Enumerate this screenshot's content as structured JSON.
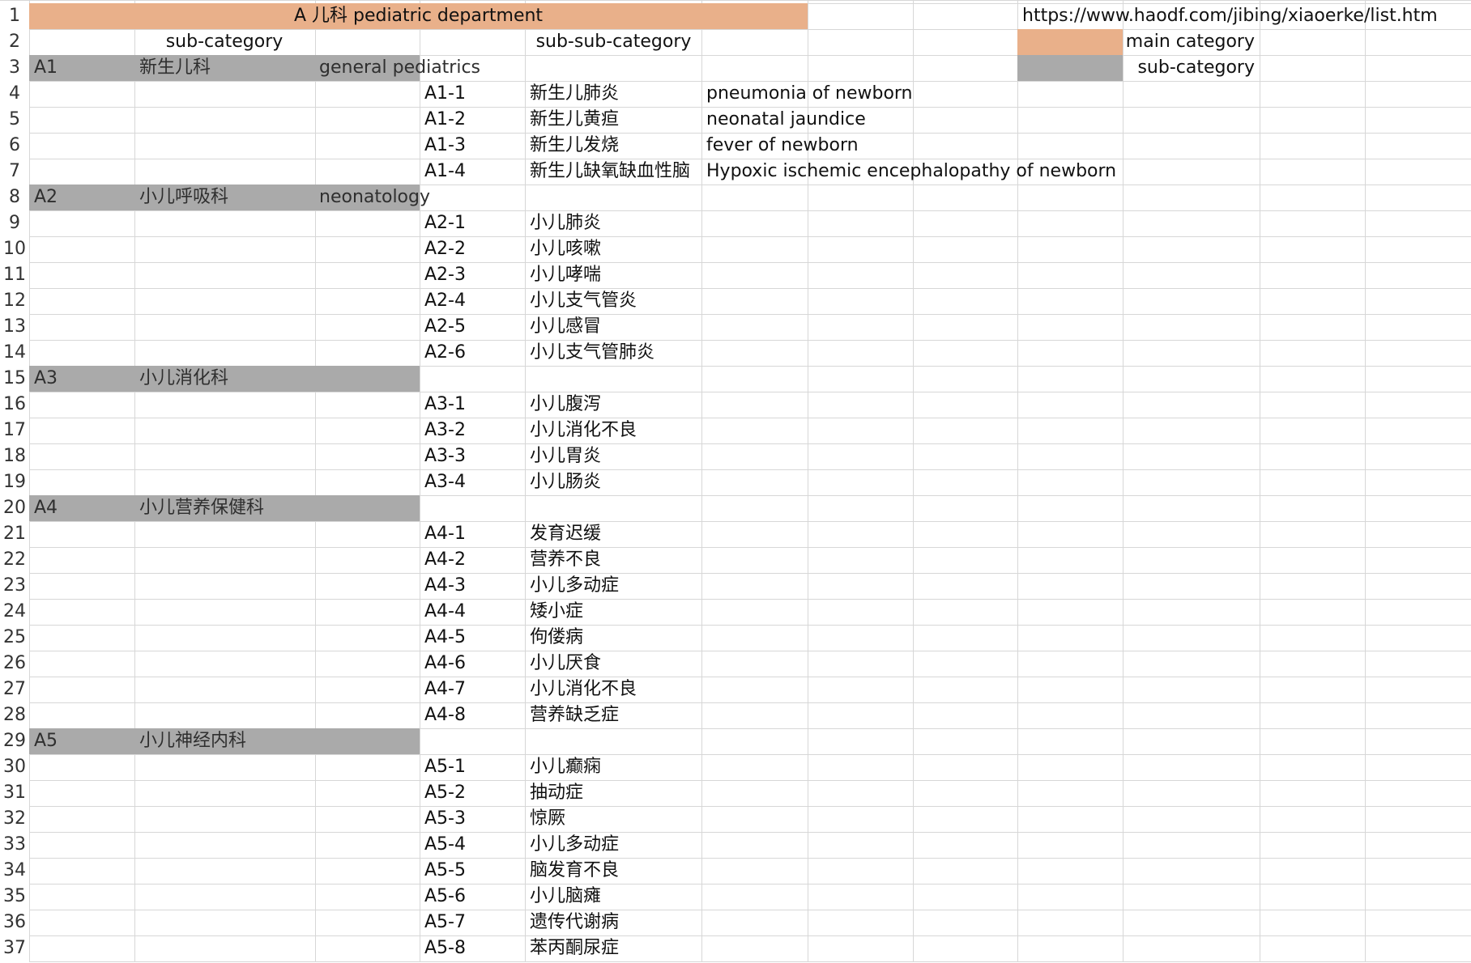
{
  "colors": {
    "main_category": "#e9b08a",
    "sub_category": "#aaaaaa",
    "grid": "#d7d7d7"
  },
  "header": {
    "title": "A 儿科 pediatric department",
    "sub_category_label": "sub-category",
    "sub_sub_category_label": "sub-sub-category"
  },
  "legend": {
    "url": "https://www.haodf.com/jibing/xiaoerke/list.htm",
    "main_label": "main category",
    "sub_label": "sub-category"
  },
  "row_numbers": [
    "1",
    "2",
    "3",
    "4",
    "5",
    "6",
    "7",
    "8",
    "9",
    "10",
    "11",
    "12",
    "13",
    "14",
    "15",
    "16",
    "17",
    "18",
    "19",
    "20",
    "21",
    "22",
    "23",
    "24",
    "25",
    "26",
    "27",
    "28",
    "29",
    "30",
    "31",
    "32",
    "33",
    "34",
    "35",
    "36",
    "37"
  ],
  "categories": [
    {
      "code": "A1",
      "name_cn": "新生儿科",
      "name_en": "general pediatrics",
      "items": [
        {
          "code": "A1-1",
          "cn": "新生儿肺炎",
          "en": "pneumonia of newborn"
        },
        {
          "code": "A1-2",
          "cn": "新生儿黄疸",
          "en": "neonatal jaundice"
        },
        {
          "code": "A1-3",
          "cn": "新生儿发烧",
          "en": "fever of newborn"
        },
        {
          "code": "A1-4",
          "cn": "新生儿缺氧缺血性脑",
          "en": "Hypoxic ischemic encephalopathy of newborn"
        }
      ]
    },
    {
      "code": "A2",
      "name_cn": "小儿呼吸科",
      "name_en": "neonatology",
      "items": [
        {
          "code": "A2-1",
          "cn": "小儿肺炎",
          "en": ""
        },
        {
          "code": "A2-2",
          "cn": "小儿咳嗽",
          "en": ""
        },
        {
          "code": "A2-3",
          "cn": "小儿哮喘",
          "en": ""
        },
        {
          "code": "A2-4",
          "cn": "小儿支气管炎",
          "en": ""
        },
        {
          "code": "A2-5",
          "cn": "小儿感冒",
          "en": ""
        },
        {
          "code": "A2-6",
          "cn": "小儿支气管肺炎",
          "en": ""
        }
      ]
    },
    {
      "code": "A3",
      "name_cn": "小儿消化科",
      "name_en": "",
      "items": [
        {
          "code": "A3-1",
          "cn": "小儿腹泻",
          "en": ""
        },
        {
          "code": "A3-2",
          "cn": "小儿消化不良",
          "en": ""
        },
        {
          "code": "A3-3",
          "cn": "小儿胃炎",
          "en": ""
        },
        {
          "code": "A3-4",
          "cn": "小儿肠炎",
          "en": ""
        }
      ]
    },
    {
      "code": "A4",
      "name_cn": "小儿营养保健科",
      "name_en": "",
      "items": [
        {
          "code": "A4-1",
          "cn": "发育迟缓",
          "en": ""
        },
        {
          "code": "A4-2",
          "cn": "营养不良",
          "en": ""
        },
        {
          "code": "A4-3",
          "cn": "小儿多动症",
          "en": ""
        },
        {
          "code": "A4-4",
          "cn": "矮小症",
          "en": ""
        },
        {
          "code": "A4-5",
          "cn": "佝偻病",
          "en": ""
        },
        {
          "code": "A4-6",
          "cn": "小儿厌食",
          "en": ""
        },
        {
          "code": "A4-7",
          "cn": "小儿消化不良",
          "en": ""
        },
        {
          "code": "A4-8",
          "cn": "营养缺乏症",
          "en": ""
        }
      ]
    },
    {
      "code": "A5",
      "name_cn": "小儿神经内科",
      "name_en": "",
      "items": [
        {
          "code": "A5-1",
          "cn": "小儿癫痫",
          "en": ""
        },
        {
          "code": "A5-2",
          "cn": "抽动症",
          "en": ""
        },
        {
          "code": "A5-3",
          "cn": "惊厥",
          "en": ""
        },
        {
          "code": "A5-4",
          "cn": "小儿多动症",
          "en": ""
        },
        {
          "code": "A5-5",
          "cn": "脑发育不良",
          "en": ""
        },
        {
          "code": "A5-6",
          "cn": "小儿脑瘫",
          "en": ""
        },
        {
          "code": "A5-7",
          "cn": "遗传代谢病",
          "en": ""
        },
        {
          "code": "A5-8",
          "cn": "苯丙酮尿症",
          "en": ""
        }
      ]
    }
  ]
}
